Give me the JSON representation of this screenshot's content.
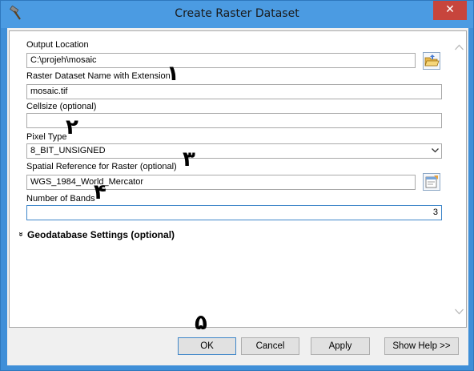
{
  "window": {
    "title": "Create Raster Dataset",
    "close_glyph": "✕"
  },
  "form": {
    "output_location": {
      "label": "Output Location",
      "value": "C:\\projeh\\mosaic"
    },
    "raster_name": {
      "label": "Raster Dataset Name with Extension",
      "value": "mosaic.tif"
    },
    "cellsize": {
      "label": "Cellsize (optional)",
      "value": ""
    },
    "pixel_type": {
      "label": "Pixel Type",
      "value": "8_BIT_UNSIGNED"
    },
    "spatial_ref": {
      "label": "Spatial Reference for Raster (optional)",
      "value": "WGS_1984_World_Mercator"
    },
    "num_bands": {
      "label": "Number of Bands",
      "value": "3"
    },
    "gdb_settings": {
      "label": "Geodatabase Settings (optional)",
      "toggle_glyph": "»"
    }
  },
  "annotations": [
    "١",
    "٢",
    "٣",
    "۴",
    "۵"
  ],
  "buttons": {
    "ok": "OK",
    "cancel": "Cancel",
    "apply": "Apply",
    "help": "Show Help >>"
  },
  "icons": {
    "app": "hammer-icon",
    "browse_folder": "open-folder-icon",
    "spatial_ref": "spatial-reference-properties-icon"
  }
}
